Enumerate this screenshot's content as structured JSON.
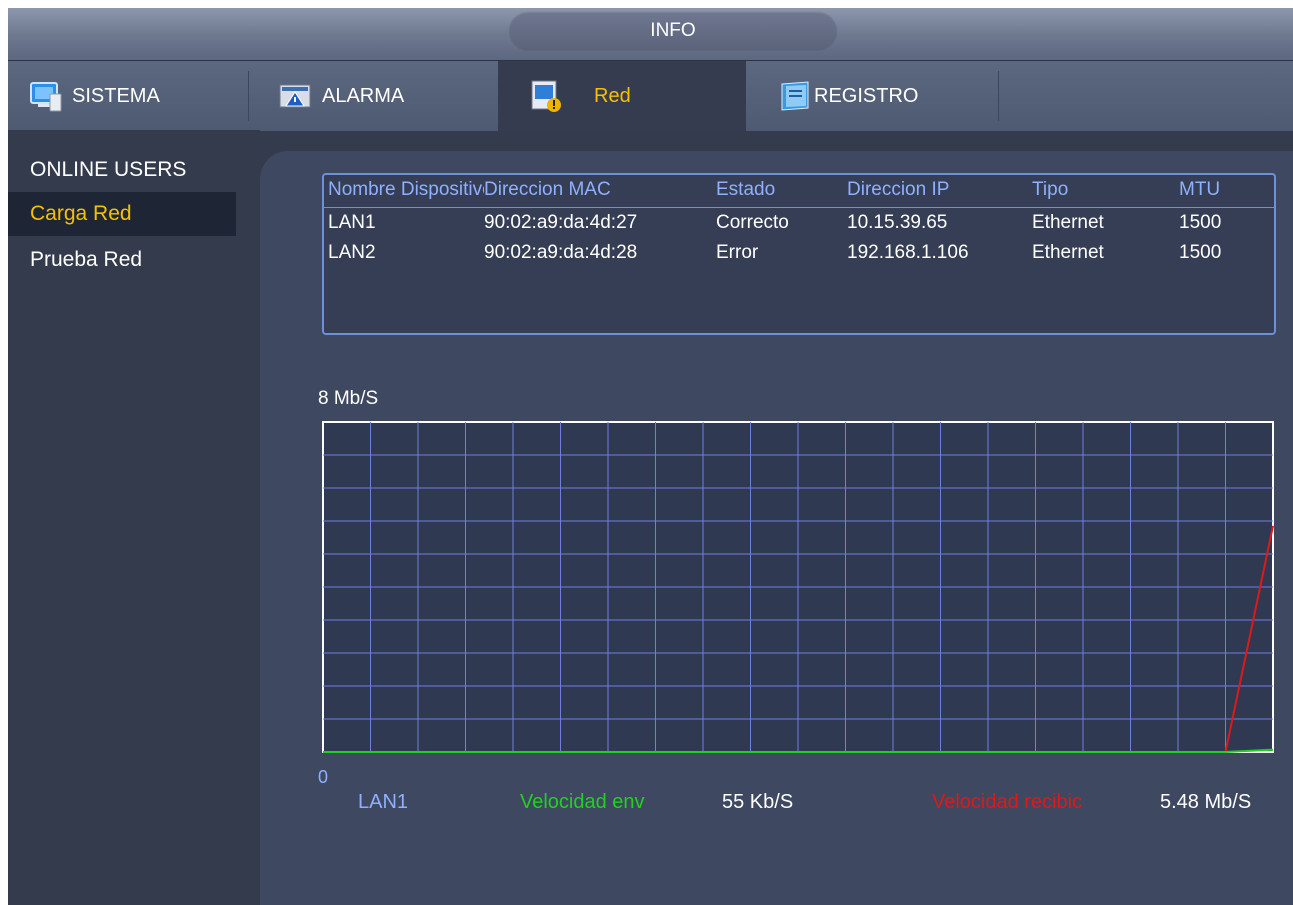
{
  "header": {
    "title": "INFO"
  },
  "tabs": [
    {
      "label": "SISTEMA",
      "icon": "monitor-icon"
    },
    {
      "label": "ALARMA",
      "icon": "alarm-icon"
    },
    {
      "label": "Red",
      "icon": "network-warning-icon"
    },
    {
      "label": "REGISTRO",
      "icon": "log-book-icon"
    }
  ],
  "sidebar": {
    "items": [
      {
        "label": "ONLINE USERS"
      },
      {
        "label": "Carga Red"
      },
      {
        "label": "Prueba Red"
      }
    ]
  },
  "table": {
    "columns": [
      "Nombre Dispositivo",
      "Direccion MAC",
      "Estado",
      "Direccion IP",
      "Tipo",
      "MTU"
    ],
    "rows": [
      [
        "LAN1",
        "90:02:a9:da:4d:27",
        "Correcto",
        "10.15.39.65",
        "Ethernet",
        "1500"
      ],
      [
        "LAN2",
        "90:02:a9:da:4d:28",
        "Error",
        "192.168.1.106",
        "Ethernet",
        "1500"
      ]
    ]
  },
  "chart_data": {
    "type": "line",
    "ymax_label": "8 Mb/S",
    "ymin_label": "0",
    "y_unit": "Mb/S",
    "ylim": [
      0,
      8
    ],
    "x": [
      0,
      1,
      2,
      3,
      4,
      5,
      6,
      7,
      8,
      9,
      10,
      11,
      12,
      13,
      14,
      15,
      16,
      17,
      18,
      19,
      20
    ],
    "series": [
      {
        "name": "Velocidad recibida",
        "color": "#e01818",
        "values": [
          0,
          0,
          0,
          0,
          0,
          0,
          0,
          0,
          0,
          0,
          0,
          0,
          0,
          0,
          0,
          0,
          0,
          0,
          0,
          0,
          5.48
        ]
      },
      {
        "name": "Velocidad enviada",
        "color": "#22d022",
        "values": [
          0,
          0,
          0,
          0,
          0,
          0,
          0,
          0,
          0,
          0,
          0,
          0,
          0,
          0,
          0,
          0,
          0,
          0,
          0,
          0,
          0.055
        ]
      }
    ],
    "grid": true
  },
  "legend": {
    "interface": "LAN1",
    "send_label": "Velocidad env",
    "send_value": "55 Kb/S",
    "recv_label": "Velocidad recibic",
    "recv_value": "5.48 Mb/S"
  },
  "colors": {
    "accent": "#f5c000",
    "header_text": "#8fb0ff",
    "send": "#22d022",
    "recv": "#e01818",
    "grid": "#6f7fe0"
  }
}
